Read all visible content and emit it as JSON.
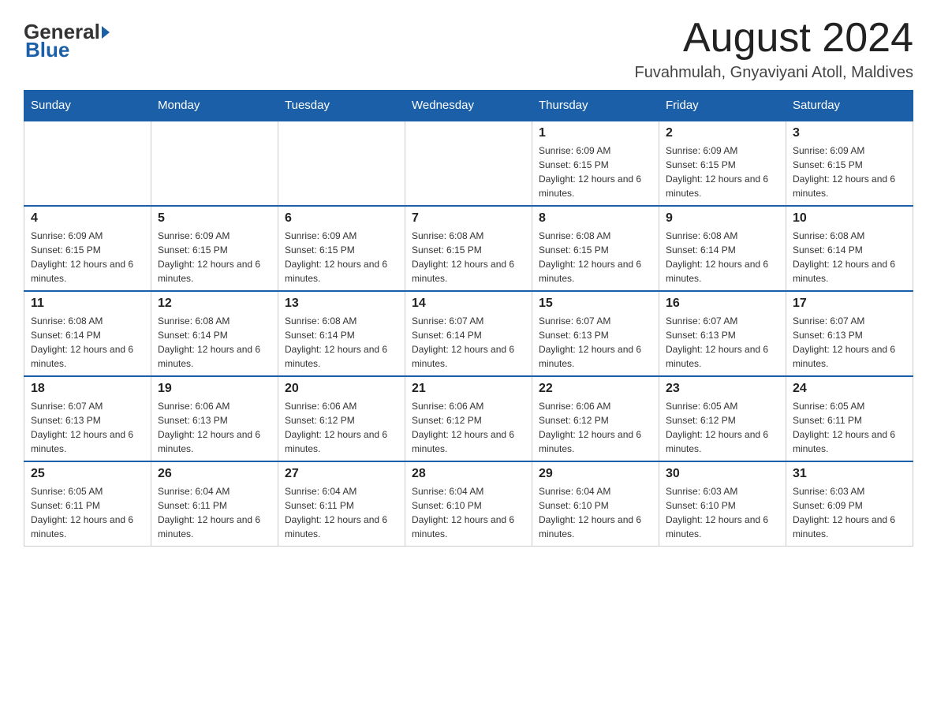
{
  "logo": {
    "general": "General",
    "blue": "Blue"
  },
  "header": {
    "month_year": "August 2024",
    "location": "Fuvahmulah, Gnyaviyani Atoll, Maldives"
  },
  "days_of_week": [
    "Sunday",
    "Monday",
    "Tuesday",
    "Wednesday",
    "Thursday",
    "Friday",
    "Saturday"
  ],
  "weeks": [
    [
      {
        "day": "",
        "info": ""
      },
      {
        "day": "",
        "info": ""
      },
      {
        "day": "",
        "info": ""
      },
      {
        "day": "",
        "info": ""
      },
      {
        "day": "1",
        "info": "Sunrise: 6:09 AM\nSunset: 6:15 PM\nDaylight: 12 hours and 6 minutes."
      },
      {
        "day": "2",
        "info": "Sunrise: 6:09 AM\nSunset: 6:15 PM\nDaylight: 12 hours and 6 minutes."
      },
      {
        "day": "3",
        "info": "Sunrise: 6:09 AM\nSunset: 6:15 PM\nDaylight: 12 hours and 6 minutes."
      }
    ],
    [
      {
        "day": "4",
        "info": "Sunrise: 6:09 AM\nSunset: 6:15 PM\nDaylight: 12 hours and 6 minutes."
      },
      {
        "day": "5",
        "info": "Sunrise: 6:09 AM\nSunset: 6:15 PM\nDaylight: 12 hours and 6 minutes."
      },
      {
        "day": "6",
        "info": "Sunrise: 6:09 AM\nSunset: 6:15 PM\nDaylight: 12 hours and 6 minutes."
      },
      {
        "day": "7",
        "info": "Sunrise: 6:08 AM\nSunset: 6:15 PM\nDaylight: 12 hours and 6 minutes."
      },
      {
        "day": "8",
        "info": "Sunrise: 6:08 AM\nSunset: 6:15 PM\nDaylight: 12 hours and 6 minutes."
      },
      {
        "day": "9",
        "info": "Sunrise: 6:08 AM\nSunset: 6:14 PM\nDaylight: 12 hours and 6 minutes."
      },
      {
        "day": "10",
        "info": "Sunrise: 6:08 AM\nSunset: 6:14 PM\nDaylight: 12 hours and 6 minutes."
      }
    ],
    [
      {
        "day": "11",
        "info": "Sunrise: 6:08 AM\nSunset: 6:14 PM\nDaylight: 12 hours and 6 minutes."
      },
      {
        "day": "12",
        "info": "Sunrise: 6:08 AM\nSunset: 6:14 PM\nDaylight: 12 hours and 6 minutes."
      },
      {
        "day": "13",
        "info": "Sunrise: 6:08 AM\nSunset: 6:14 PM\nDaylight: 12 hours and 6 minutes."
      },
      {
        "day": "14",
        "info": "Sunrise: 6:07 AM\nSunset: 6:14 PM\nDaylight: 12 hours and 6 minutes."
      },
      {
        "day": "15",
        "info": "Sunrise: 6:07 AM\nSunset: 6:13 PM\nDaylight: 12 hours and 6 minutes."
      },
      {
        "day": "16",
        "info": "Sunrise: 6:07 AM\nSunset: 6:13 PM\nDaylight: 12 hours and 6 minutes."
      },
      {
        "day": "17",
        "info": "Sunrise: 6:07 AM\nSunset: 6:13 PM\nDaylight: 12 hours and 6 minutes."
      }
    ],
    [
      {
        "day": "18",
        "info": "Sunrise: 6:07 AM\nSunset: 6:13 PM\nDaylight: 12 hours and 6 minutes."
      },
      {
        "day": "19",
        "info": "Sunrise: 6:06 AM\nSunset: 6:13 PM\nDaylight: 12 hours and 6 minutes."
      },
      {
        "day": "20",
        "info": "Sunrise: 6:06 AM\nSunset: 6:12 PM\nDaylight: 12 hours and 6 minutes."
      },
      {
        "day": "21",
        "info": "Sunrise: 6:06 AM\nSunset: 6:12 PM\nDaylight: 12 hours and 6 minutes."
      },
      {
        "day": "22",
        "info": "Sunrise: 6:06 AM\nSunset: 6:12 PM\nDaylight: 12 hours and 6 minutes."
      },
      {
        "day": "23",
        "info": "Sunrise: 6:05 AM\nSunset: 6:12 PM\nDaylight: 12 hours and 6 minutes."
      },
      {
        "day": "24",
        "info": "Sunrise: 6:05 AM\nSunset: 6:11 PM\nDaylight: 12 hours and 6 minutes."
      }
    ],
    [
      {
        "day": "25",
        "info": "Sunrise: 6:05 AM\nSunset: 6:11 PM\nDaylight: 12 hours and 6 minutes."
      },
      {
        "day": "26",
        "info": "Sunrise: 6:04 AM\nSunset: 6:11 PM\nDaylight: 12 hours and 6 minutes."
      },
      {
        "day": "27",
        "info": "Sunrise: 6:04 AM\nSunset: 6:11 PM\nDaylight: 12 hours and 6 minutes."
      },
      {
        "day": "28",
        "info": "Sunrise: 6:04 AM\nSunset: 6:10 PM\nDaylight: 12 hours and 6 minutes."
      },
      {
        "day": "29",
        "info": "Sunrise: 6:04 AM\nSunset: 6:10 PM\nDaylight: 12 hours and 6 minutes."
      },
      {
        "day": "30",
        "info": "Sunrise: 6:03 AM\nSunset: 6:10 PM\nDaylight: 12 hours and 6 minutes."
      },
      {
        "day": "31",
        "info": "Sunrise: 6:03 AM\nSunset: 6:09 PM\nDaylight: 12 hours and 6 minutes."
      }
    ]
  ]
}
